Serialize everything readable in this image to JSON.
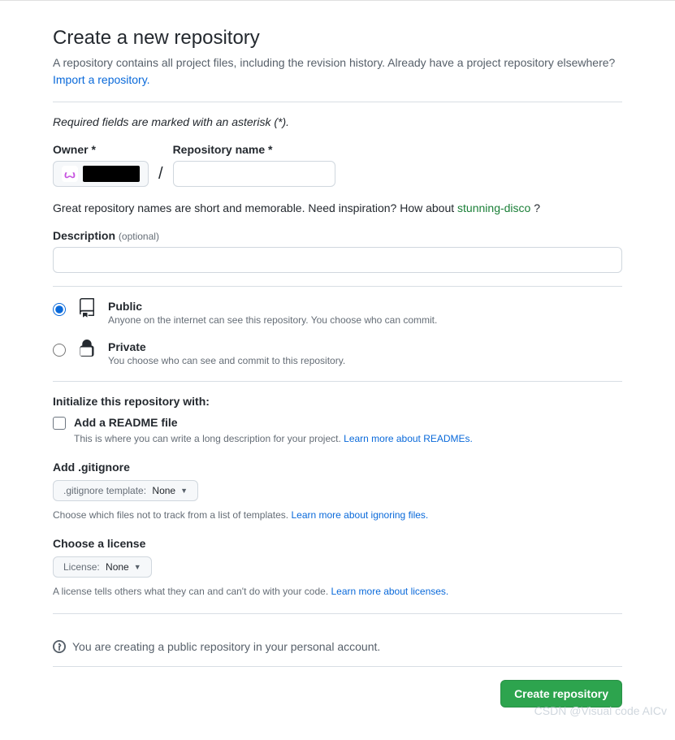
{
  "header": {
    "title": "Create a new repository",
    "subtitle": "A repository contains all project files, including the revision history. Already have a project repository elsewhere?",
    "import_link": "Import a repository."
  },
  "required_note": "Required fields are marked with an asterisk (*).",
  "owner": {
    "label": "Owner *"
  },
  "repo_name": {
    "label": "Repository name *",
    "value": ""
  },
  "name_hint": {
    "prefix": "Great repository names are short and memorable. Need inspiration? How about ",
    "suggestion": "stunning-disco",
    "suffix": " ?"
  },
  "description": {
    "label": "Description",
    "optional": "(optional)",
    "value": ""
  },
  "visibility": {
    "public": {
      "title": "Public",
      "desc": "Anyone on the internet can see this repository. You choose who can commit."
    },
    "private": {
      "title": "Private",
      "desc": "You choose who can see and commit to this repository."
    }
  },
  "init": {
    "title": "Initialize this repository with:",
    "readme": {
      "label": "Add a README file",
      "desc": "This is where you can write a long description for your project. ",
      "link": "Learn more about READMEs."
    }
  },
  "gitignore": {
    "label": "Add .gitignore",
    "select_prefix": ".gitignore template:",
    "select_value": "None",
    "help": "Choose which files not to track from a list of templates. ",
    "link": "Learn more about ignoring files."
  },
  "license": {
    "label": "Choose a license",
    "select_prefix": "License:",
    "select_value": "None",
    "help": "A license tells others what they can and can't do with your code. ",
    "link": "Learn more about licenses."
  },
  "info": "You are creating a public repository in your personal account.",
  "submit": "Create repository",
  "watermark": "CSDN @Visual code AICv"
}
